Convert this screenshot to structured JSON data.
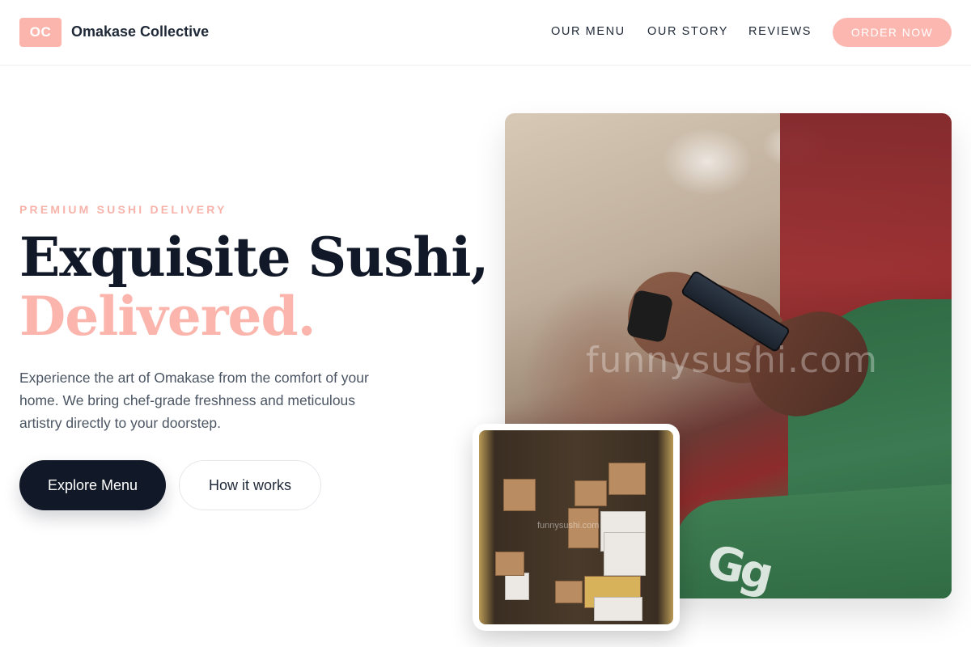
{
  "header": {
    "logo_initials": "OC",
    "brand_name": "Omakase Collective",
    "nav": {
      "menu": "OUR MENU",
      "story": "OUR STORY",
      "reviews": "REVIEWS"
    },
    "cta": "ORDER NOW"
  },
  "hero": {
    "eyebrow": "PREMIUM SUSHI DELIVERY",
    "headline_line1": "Exquisite Sushi,",
    "headline_line2": "Delivered.",
    "description": "Experience the art of Omakase from the comfort of your home. We bring chef-grade freshness and meticulous artistry directly to your doorstep.",
    "primary_button": "Explore Menu",
    "secondary_button": "How it works",
    "photo_watermark": "funnysushi.com",
    "inset_watermark": "funnysushi.com"
  },
  "colors": {
    "accent": "#fbb5ac",
    "dark": "#111827"
  }
}
